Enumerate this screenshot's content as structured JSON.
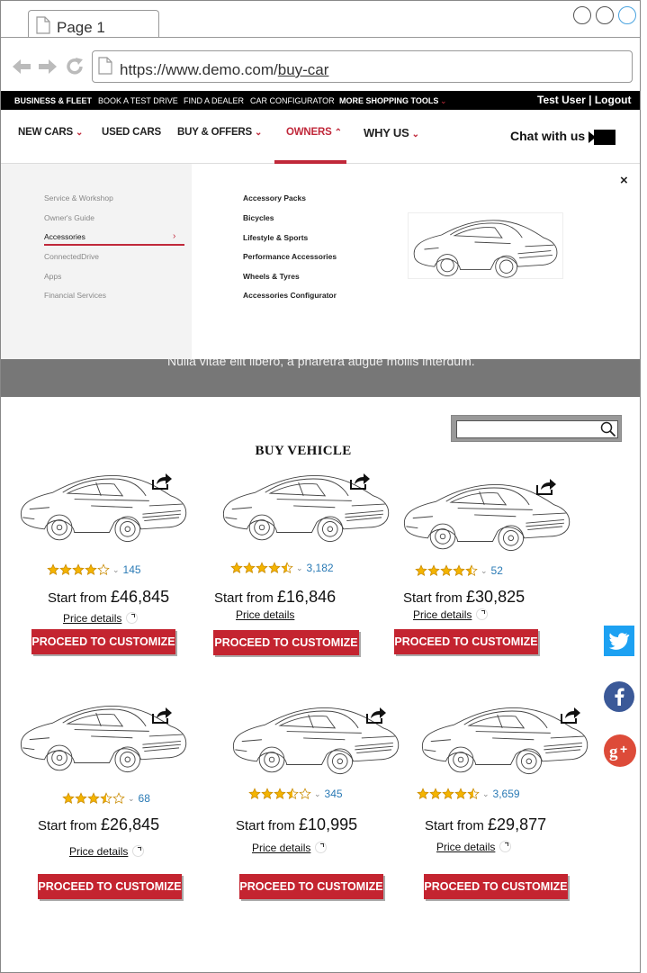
{
  "browser": {
    "tab_title": "Page 1",
    "url_prefix": "https://www.demo.com/",
    "url_path": "buy-car"
  },
  "topbar": {
    "links": [
      "BUSINESS & FLEET",
      "BOOK A TEST DRIVE",
      "FIND A DEALER",
      "CAR CONFIGURATOR",
      "MORE SHOPPING TOOLS"
    ],
    "user": "Test User | Logout"
  },
  "nav": {
    "items": [
      "NEW CARS",
      "USED CARS",
      "BUY & OFFERS",
      "OWNERS",
      "WHY US"
    ],
    "chat": "Chat with us"
  },
  "mega": {
    "sub": [
      "Service & Workshop",
      "Owner's Guide",
      "Accessories",
      "ConnectedDrive",
      "Apps",
      "Financial Services"
    ],
    "accessories": [
      "Accessory Packs",
      "Bicycles",
      "Lifestyle & Sports",
      "Performance Accessories",
      "Wheels & Tyres",
      "Accessories Configurator"
    ],
    "close": "×"
  },
  "hero": {
    "text": "Nulla vitae elit libero, a pharetra augue mollis interdum."
  },
  "section_title": "BUY VEHICLE",
  "cards": [
    {
      "rating": 4,
      "reviews": "145",
      "price_label": "Start from",
      "price": "£46,845",
      "details": "Price details",
      "cta": "PROCEED TO CUSTOMIZE"
    },
    {
      "rating": 4.5,
      "reviews": "3,182",
      "price_label": "Start from",
      "price": "£16,846",
      "details": "Price details",
      "cta": "PROCEED TO CUSTOMIZE"
    },
    {
      "rating": 4.5,
      "reviews": "52",
      "price_label": "Start from",
      "price": "£30,825",
      "details": "Price details",
      "cta": "PROCEED TO CUSTOMIZE"
    },
    {
      "rating": 3.5,
      "reviews": "68",
      "price_label": "Start from",
      "price": "£26,845",
      "details": "Price details",
      "cta": "PROCEED TO CUSTOMIZE"
    },
    {
      "rating": 3.5,
      "reviews": "345",
      "price_label": "Start from",
      "price": "£10,995",
      "details": "Price details",
      "cta": "PROCEED TO CUSTOMIZE"
    },
    {
      "rating": 4.5,
      "reviews": "3,659",
      "price_label": "Start from",
      "price": "£29,877",
      "details": "Price details",
      "cta": "PROCEED TO CUSTOMIZE"
    }
  ],
  "social": [
    "twitter-icon",
    "facebook-icon",
    "google-plus-icon"
  ],
  "colors": {
    "accent": "#c0283a",
    "cta": "#c42430",
    "star": "#f4b400",
    "twitter": "#1da1f2",
    "facebook": "#3b5998",
    "google": "#dd4b39"
  }
}
